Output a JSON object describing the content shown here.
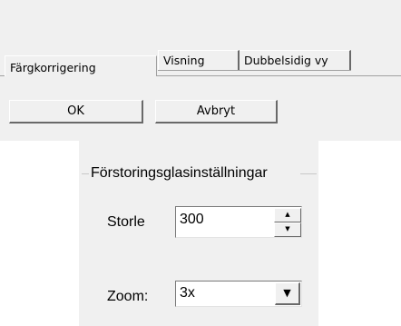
{
  "tabs": [
    {
      "label": "Färgkorrigering"
    },
    {
      "label": "Visning"
    },
    {
      "label": "Dubbelsidig vy"
    }
  ],
  "buttons": {
    "ok": "OK",
    "cancel": "Avbryt"
  },
  "magnifier": {
    "group_title": "Förstoringsglasinställningar",
    "size_label": "Storle",
    "size_value": "300",
    "zoom_label": "Zoom:",
    "zoom_value": "3x"
  },
  "icons": {
    "spin_up": "triangle-up",
    "spin_down": "triangle-down",
    "dropdown": "triangle-down"
  }
}
